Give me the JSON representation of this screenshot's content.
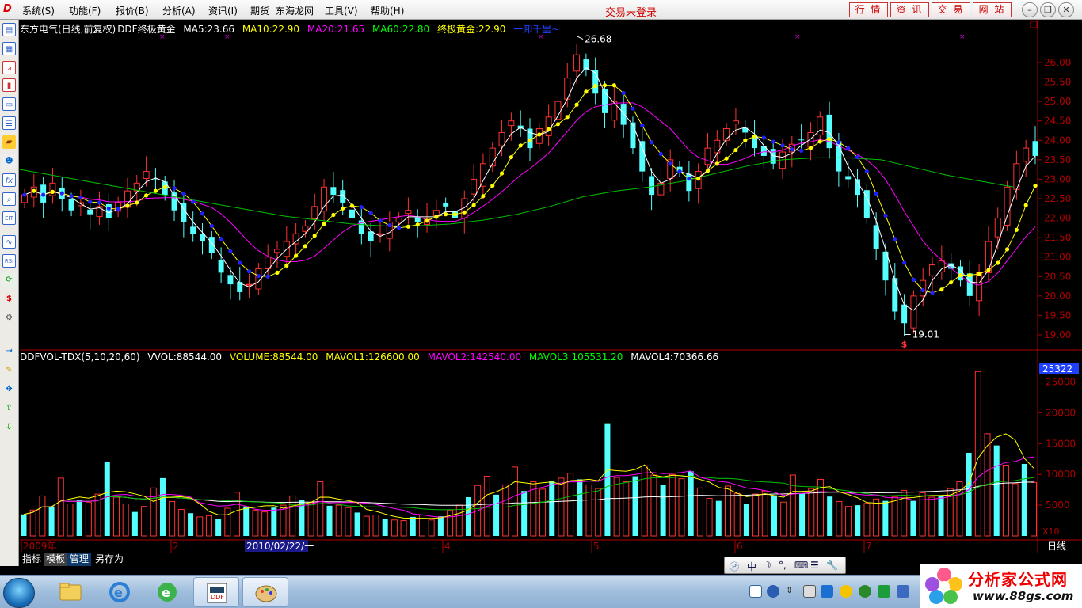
{
  "menu": {
    "items": [
      "系统(S)",
      "功能(F)",
      "报价(B)",
      "分析(A)",
      "资讯(I)",
      "期货",
      "东海龙网",
      "工具(V)",
      "帮助(H)"
    ],
    "status": "交易未登录",
    "right_buttons": [
      "行 情",
      "资 讯",
      "交 易",
      "网 站"
    ]
  },
  "main_info": {
    "title": "东方电气(日线,前复权)",
    "indicator": "DDF终极黄金",
    "ma5": "MA5:23.66",
    "ma10": "MA10:22.90",
    "ma20": "MA20:21.65",
    "ma60": "MA60:22.80",
    "zjhj": "终极黄金:22.90",
    "ctrl": "一卸千里~"
  },
  "vol_info": {
    "name": "DDFVOL-TDX(5,10,20,60)",
    "vvol": "VVOL:88544.00",
    "volume": "VOLUME:88544.00",
    "mavol1": "MAVOL1:126600.00",
    "mavol2": "MAVOL2:142540.00",
    "mavol3": "MAVOL3:105531.20",
    "mavol4": "MAVOL4:70366.66"
  },
  "price_axis": [
    "26.00",
    "25.50",
    "25.00",
    "24.50",
    "24.00",
    "23.50",
    "23.00",
    "22.50",
    "22.00",
    "21.50",
    "21.00",
    "20.50",
    "20.00",
    "19.50",
    "19.00"
  ],
  "vol_axis": {
    "top_value": "25322",
    "labels": [
      "25000",
      "20000",
      "15000",
      "10000",
      "5000"
    ],
    "unit": "X10"
  },
  "annotations": {
    "high": "26.68",
    "low": "19.01",
    "low_marker": "$"
  },
  "date_axis": {
    "labels": [
      "2009年",
      "2",
      "4",
      "5",
      "6",
      "7"
    ],
    "cursor_date": "2010/02/22/一",
    "period": "日线"
  },
  "tabs": [
    "指标",
    "模板",
    "管理",
    "另存为"
  ],
  "ime": {
    "lang": "中"
  },
  "watermark": {
    "title": "分析家公式网",
    "url": "www.88gs.com"
  },
  "colors": {
    "up": "#ff3232",
    "down": "#54ffff",
    "ma5": "#ffffff",
    "ma10": "#ffff00",
    "ma20": "#ff00ff",
    "ma60": "#00c000",
    "gold_dot": "#ffff00",
    "blue_dot": "#2020ff",
    "axis": "#b00000"
  },
  "chart_data": {
    "type": "candlestick",
    "symbol": "东方电气",
    "period": "日线",
    "price_range": [
      18.8,
      26.9
    ],
    "close_series": [
      22.6,
      22.8,
      22.4,
      22.9,
      22.5,
      22.2,
      22.4,
      22.1,
      22.3,
      22.0,
      22.4,
      22.7,
      22.9,
      23.2,
      23.0,
      22.6,
      22.2,
      21.9,
      21.6,
      21.4,
      21.1,
      20.6,
      20.3,
      20.1,
      20.3,
      20.7,
      21.0,
      21.2,
      21.4,
      21.6,
      21.8,
      22.3,
      22.8,
      22.6,
      22.4,
      22.0,
      21.6,
      21.4,
      21.6,
      21.9,
      22.0,
      22.2,
      21.9,
      22.0,
      22.2,
      22.3,
      22.0,
      22.5,
      23.0,
      23.4,
      23.8,
      24.2,
      24.5,
      24.3,
      23.8,
      24.3,
      24.6,
      25.0,
      25.6,
      26.2,
      25.8,
      25.2,
      24.7,
      25.0,
      24.4,
      23.8,
      23.2,
      22.6,
      22.9,
      23.5,
      23.2,
      22.7,
      23.2,
      23.8,
      24.0,
      24.3,
      24.5,
      24.2,
      23.8,
      23.6,
      23.4,
      23.7,
      23.9,
      24.0,
      24.2,
      24.6,
      23.8,
      23.2,
      23.0,
      22.6,
      22.0,
      21.2,
      20.4,
      19.6,
      19.3,
      20.0,
      20.4,
      20.8,
      20.9,
      20.7,
      20.4,
      20.0,
      20.6,
      21.4,
      22.0,
      22.8,
      23.4,
      23.8,
      23.6
    ],
    "ma60_series": [
      23.25,
      23.1,
      22.95,
      22.8,
      22.65,
      22.5,
      22.35,
      22.2,
      22.05,
      21.95,
      21.85,
      21.8,
      21.8,
      21.85,
      21.95,
      22.1,
      22.3,
      22.55,
      22.7,
      22.8,
      22.95,
      23.15,
      23.35,
      23.5,
      23.55,
      23.55,
      23.5,
      23.3,
      23.1,
      22.95,
      22.8
    ],
    "volume_series": [
      3500,
      4200,
      6500,
      4800,
      9400,
      5200,
      5800,
      5500,
      6800,
      12000,
      6300,
      5200,
      3900,
      4800,
      7800,
      9400,
      5600,
      4300,
      3700,
      3100,
      3300,
      2700,
      4500,
      7100,
      4800,
      4200,
      3900,
      4600,
      5000,
      6500,
      5800,
      5400,
      8800,
      4900,
      5000,
      4600,
      3800,
      3200,
      3400,
      2800,
      2600,
      2500,
      3100,
      3400,
      2600,
      3200,
      4200,
      5000,
      6300,
      8200,
      9700,
      6700,
      8300,
      11200,
      7300,
      8800,
      7600,
      8900,
      9400,
      10200,
      9200,
      8300,
      7700,
      18300,
      9500,
      8800,
      9700,
      11400,
      9900,
      8300,
      10000,
      9300,
      10500,
      7800,
      6100,
      5700,
      8100,
      6900,
      5200,
      6800,
      7300,
      6600,
      5500,
      9900,
      6900,
      7700,
      9200,
      6400,
      5600,
      4800,
      5000,
      5300,
      6000,
      5700,
      6400,
      7400,
      5700,
      7000,
      6300,
      6500,
      7700,
      8800,
      13500,
      26700,
      16600,
      14700,
      11500,
      8500,
      11700,
      8700
    ],
    "annotations": {
      "high": 26.68,
      "low": 19.01
    },
    "mavol_last": {
      "MAVOL1": 126600.0,
      "MAVOL2": 142540.0,
      "MAVOL3": 105531.2,
      "MAVOL4": 70366.66
    }
  }
}
